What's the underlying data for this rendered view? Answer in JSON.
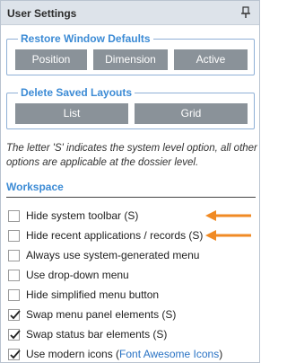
{
  "panel": {
    "title": "User Settings",
    "pin_icon": "pin-icon"
  },
  "restore_group": {
    "legend": "Restore Window Defaults",
    "buttons": [
      "Position",
      "Dimension",
      "Active"
    ]
  },
  "delete_group": {
    "legend": "Delete Saved Layouts",
    "buttons": [
      "List",
      "Grid"
    ]
  },
  "note": "The letter 'S' indicates the system level option, all other options are applicable at the dossier level.",
  "workspace": {
    "title": "Workspace",
    "options": [
      {
        "label": "Hide system toolbar (S)",
        "checked": false
      },
      {
        "label": "Hide recent applications / records (S)",
        "checked": false
      },
      {
        "label": "Always use system-generated menu",
        "checked": false
      },
      {
        "label": "Use drop-down menu",
        "checked": false
      },
      {
        "label": "Hide simplified menu button",
        "checked": false
      },
      {
        "label": "Swap menu panel elements (S)",
        "checked": true
      },
      {
        "label": "Swap status bar elements (S)",
        "checked": true
      },
      {
        "label": "Use modern icons (",
        "link": "Font Awesome Icons",
        "suffix": ")",
        "checked": true
      }
    ]
  },
  "colors": {
    "accent": "#3c8bd5",
    "button": "#8a9299",
    "arrow": "#f08a24"
  }
}
